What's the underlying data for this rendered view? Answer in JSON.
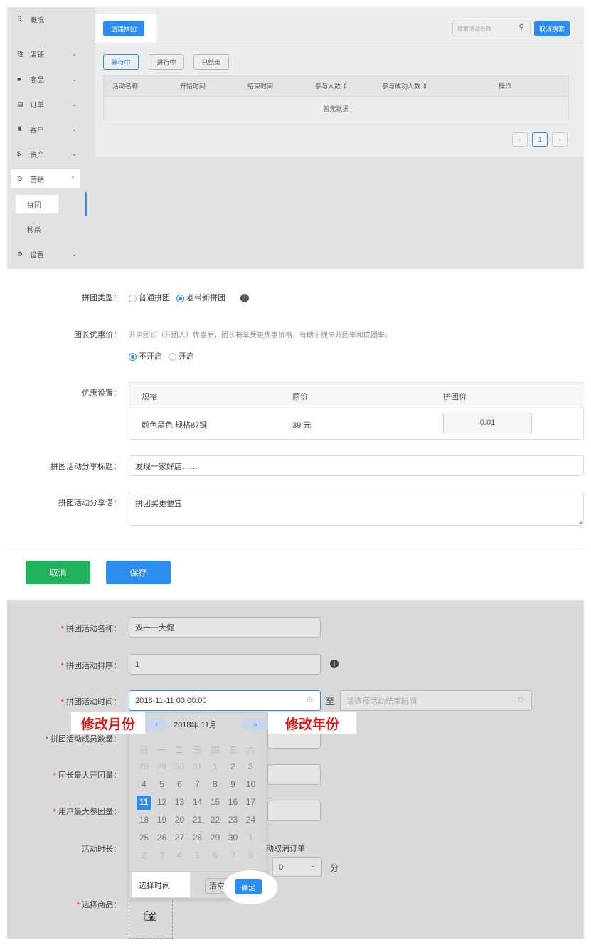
{
  "colors": {
    "accent": "#2d8cf0",
    "success": "#21b35b",
    "required": "#e02020",
    "annotation": "#e01818"
  },
  "panel1": {
    "sidebar": [
      {
        "icon": "grid-icon",
        "glyph": "⠿",
        "label": "概况",
        "chevron": ""
      },
      {
        "icon": "store-icon",
        "glyph": "珄",
        "label": "店铺",
        "chevron": "⌄"
      },
      {
        "icon": "goods-icon",
        "glyph": "■",
        "label": "商品",
        "chevron": "⌄"
      },
      {
        "icon": "order-icon",
        "glyph": "▤",
        "label": "订单",
        "chevron": "⌄"
      },
      {
        "icon": "customer-icon",
        "glyph": "♜",
        "label": "客户",
        "chevron": "⌄"
      },
      {
        "icon": "dollar-icon",
        "glyph": "$",
        "label": "资产",
        "chevron": "⌄"
      },
      {
        "icon": "marketing-icon",
        "glyph": "⊙",
        "label": "营销",
        "chevron": "⌃"
      },
      {
        "icon": "",
        "glyph": "",
        "label": "拼团",
        "chevron": ""
      },
      {
        "icon": "",
        "glyph": "",
        "label": "秒杀",
        "chevron": ""
      },
      {
        "icon": "gear-icon",
        "glyph": "⚙",
        "label": "设置",
        "chevron": "⌄"
      }
    ],
    "create_button": "创建拼团",
    "search_placeholder": "搜索活动名称",
    "cancel_search": "取消搜索",
    "status_tabs": [
      "等待中",
      "进行中",
      "已结束"
    ],
    "table_headers": [
      "活动名称",
      "开始时间",
      "结束时间",
      "参与人数 ⇕",
      "参与成功人数 ⇕",
      "操作"
    ],
    "empty_text": "暂无数据",
    "pagination": {
      "prev": "‹",
      "page": "1",
      "next": "›"
    }
  },
  "panel2": {
    "type_label": "拼团类型：",
    "type_options": [
      "普通拼团",
      "老带新拼团"
    ],
    "leader_label": "团长优惠价：",
    "leader_help": "开启团长（开团人）优惠后，团长将享受更优惠价格，有助于提高开团率和成团率。",
    "leader_options": [
      "不开启",
      "开启"
    ],
    "discount_label": "优惠设置：",
    "discount_headers": [
      "规格",
      "原价",
      "拼团价"
    ],
    "discount_row": {
      "spec": "颜色黑色,规格87键",
      "price": "39 元",
      "group_price": "0.01"
    },
    "share_title_label": "拼图活动分享标题：",
    "share_title_value": "发现一家好店……",
    "share_text_label": "拼团活动分享语：",
    "share_text_value": "拼团买更便宜",
    "cancel": "取消",
    "save": "保存"
  },
  "panel3": {
    "name_label": "拼团活动名称：",
    "name_value": "双十一大促",
    "sort_label": "拼团活动排序：",
    "sort_value": "1",
    "time_label": "拼团活动时间：",
    "start_time": "2018-11-11 00:00:00",
    "to": "至",
    "end_placeholder": "请选择活动结束时间",
    "members_label": "拼团活动成员数量：",
    "max_open_label": "团长最大开团量：",
    "max_join_label": "用户最大参团量：",
    "duration_label": "活动时长：",
    "auto_cancel": "动取消订单",
    "minute_value": "0",
    "minute_unit": "分",
    "goods_label": "选择商品：",
    "calendar": {
      "title": "2018年 11月",
      "prev_month": "‹",
      "next_year": "»",
      "weekdays": [
        "日",
        "一",
        "二",
        "三",
        "四",
        "五",
        "六"
      ],
      "days": [
        [
          "28",
          "29",
          "30",
          "31",
          "1",
          "2",
          "3"
        ],
        [
          "4",
          "5",
          "6",
          "7",
          "8",
          "9",
          "10"
        ],
        [
          "11",
          "12",
          "13",
          "14",
          "15",
          "16",
          "17"
        ],
        [
          "18",
          "19",
          "20",
          "21",
          "22",
          "23",
          "24"
        ],
        [
          "25",
          "26",
          "27",
          "28",
          "29",
          "30",
          "1"
        ],
        [
          "2",
          "3",
          "4",
          "5",
          "6",
          "7",
          "8"
        ]
      ],
      "gray": [
        [
          true,
          true,
          true,
          true,
          false,
          false,
          false
        ],
        [
          false,
          false,
          false,
          false,
          false,
          false,
          false
        ],
        [
          false,
          false,
          false,
          false,
          false,
          false,
          false
        ],
        [
          false,
          false,
          false,
          false,
          false,
          false,
          false
        ],
        [
          false,
          false,
          false,
          false,
          false,
          false,
          true
        ],
        [
          true,
          true,
          true,
          true,
          true,
          true,
          true
        ]
      ],
      "selected": "11",
      "select_time": "选择时间",
      "clear": "清空",
      "confirm": "确定"
    },
    "annotations": {
      "month": "修改月份",
      "year": "修改年份"
    }
  }
}
